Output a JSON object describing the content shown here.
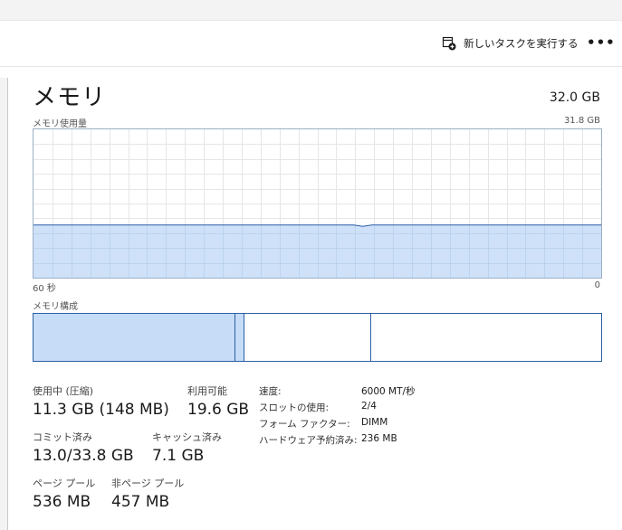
{
  "toolbar": {
    "run_new_task_label": "新しいタスクを実行する",
    "more_label": "•••"
  },
  "memory": {
    "title": "メモリ",
    "total": "32.0 GB",
    "usage_graph": {
      "label": "メモリ使用量",
      "max_label": "31.8 GB",
      "time_left": "60 秒",
      "time_right": "0",
      "max_gb": 31.8,
      "used_gb": 11.3,
      "fill_color": "#c6dcf7",
      "line_color": "#2c5fa5",
      "grid_color": "#e6e6e6"
    },
    "composition": {
      "label": "メモリ構成",
      "in_use_gb": 11.3,
      "modified_gb": 0.5,
      "standby_gb": 7.1,
      "free_gb": 12.9,
      "fill_color": "#c6dcf7",
      "border_color": "#2c5fa5"
    },
    "stats": {
      "in_use_label": "使用中 (圧縮)",
      "in_use_value": "11.3 GB (148 MB)",
      "available_label": "利用可能",
      "available_value": "19.6 GB",
      "committed_label": "コミット済み",
      "committed_value": "13.0/33.8 GB",
      "cached_label": "キャッシュ済み",
      "cached_value": "7.1 GB",
      "paged_pool_label": "ページ プール",
      "paged_pool_value": "536 MB",
      "nonpaged_pool_label": "非ページ プール",
      "nonpaged_pool_value": "457 MB"
    },
    "details": {
      "speed_label": "速度:",
      "speed_value": "6000 MT/秒",
      "slots_label": "スロットの使用:",
      "slots_value": "2/4",
      "form_factor_label": "フォーム ファクター:",
      "form_factor_value": "DIMM",
      "hw_reserved_label": "ハードウェア予約済み:",
      "hw_reserved_value": "236 MB"
    }
  }
}
